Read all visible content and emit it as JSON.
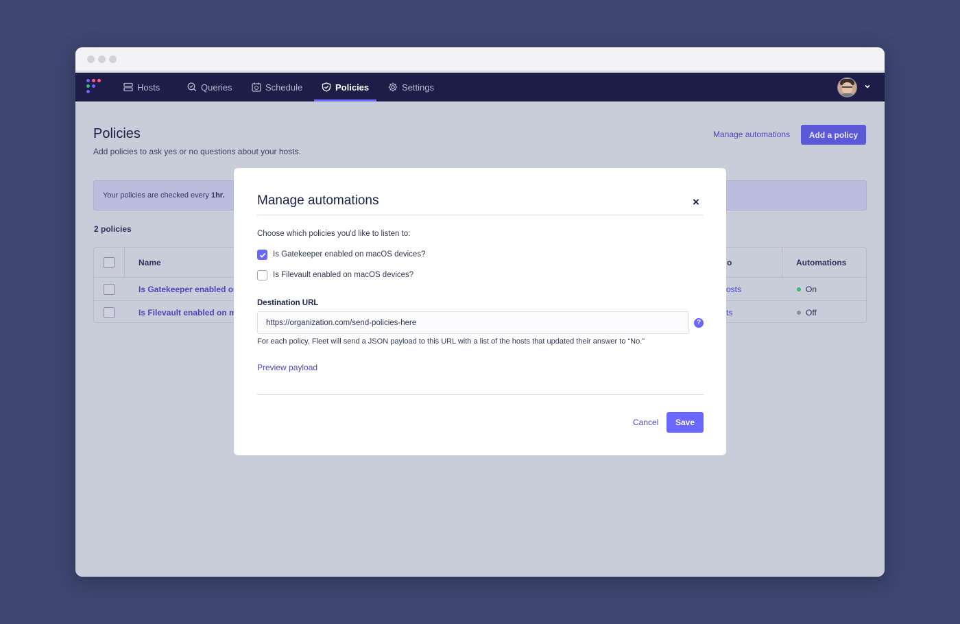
{
  "nav": {
    "items": [
      {
        "label": "Hosts",
        "icon": "hosts-icon"
      },
      {
        "label": "Queries",
        "icon": "queries-icon"
      },
      {
        "label": "Schedule",
        "icon": "schedule-icon"
      },
      {
        "label": "Policies",
        "icon": "shield-icon",
        "active": true
      },
      {
        "label": "Settings",
        "icon": "gear-icon"
      }
    ]
  },
  "page": {
    "title": "Policies",
    "subtitle": "Add policies to ask yes or no questions about your hosts.",
    "manage_link": "Manage automations",
    "add_button": "Add a policy",
    "banner_prefix": "Your policies are checked every ",
    "banner_interval": "1hr.",
    "count": "2 policies"
  },
  "table": {
    "headers": {
      "name": "Name",
      "partial_header": "o",
      "automations": "Automations"
    },
    "rows": [
      {
        "name": "Is Gatekeeper enabled on",
        "hosts": "osts",
        "automation": "On",
        "status_color": "#3db67b"
      },
      {
        "name": "Is Filevault enabled on ma",
        "hosts": "ts",
        "automation": "Off",
        "status_color": "#8b8fa2"
      }
    ]
  },
  "modal": {
    "title": "Manage automations",
    "close": "×",
    "prompt": "Choose which policies you'd like to listen to:",
    "options": [
      {
        "label": "Is Gatekeeper enabled on macOS devices?",
        "checked": true
      },
      {
        "label": "Is Filevault enabled on macOS devices?",
        "checked": false
      }
    ],
    "url_label": "Destination URL",
    "url_value": "https://organization.com/send-policies-here",
    "help": "?",
    "helper_text": "For each policy, Fleet will send a JSON payload to this URL with a list of the hosts that updated their answer to “No.”",
    "preview": "Preview payload",
    "cancel": "Cancel",
    "save": "Save"
  },
  "colors": {
    "accent": "#6a67fe",
    "nav_bg": "#1d1d47",
    "background": "#3e4671"
  }
}
